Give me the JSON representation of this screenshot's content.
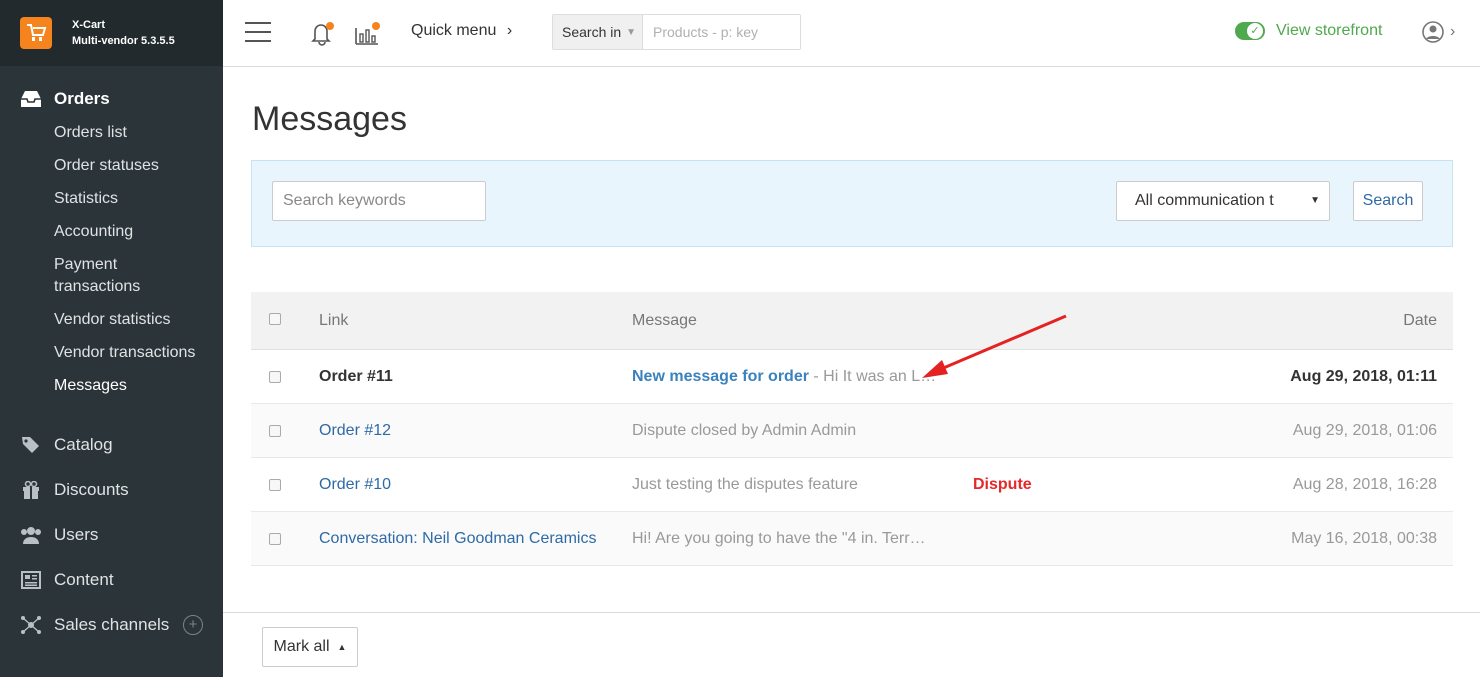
{
  "brand": {
    "name": "X-Cart",
    "version": "Multi-vendor 5.3.5.5"
  },
  "sidebar": {
    "sections": [
      {
        "label": "Orders",
        "icon": "inbox-icon",
        "active": true,
        "items": [
          "Orders list",
          "Order statuses",
          "Statistics",
          "Accounting",
          "Payment transactions",
          "Vendor statistics",
          "Vendor transactions",
          "Messages"
        ],
        "current_item": "Messages"
      },
      {
        "label": "Catalog",
        "icon": "tags-icon"
      },
      {
        "label": "Discounts",
        "icon": "gift-icon"
      },
      {
        "label": "Users",
        "icon": "users-icon"
      },
      {
        "label": "Content",
        "icon": "newspaper-icon"
      },
      {
        "label": "Sales channels",
        "icon": "network-icon"
      }
    ]
  },
  "topbar": {
    "quick_menu": "Quick menu",
    "search_in_label": "Search in",
    "search_placeholder": "Products - p: key",
    "view_storefront": "View storefront",
    "accent_color": "#4fa94e"
  },
  "page": {
    "title": "Messages"
  },
  "filters": {
    "keywords_placeholder": "Search keywords",
    "communication_select": "All communication t",
    "search_button": "Search"
  },
  "table": {
    "headers": {
      "link": "Link",
      "message": "Message",
      "date": "Date"
    },
    "rows": [
      {
        "link": "Order #11",
        "subject": "New message for order",
        "separator": " - ",
        "message": "Hi It was an L…",
        "badge": "",
        "date": "Aug 29, 2018, 01:11",
        "unread": true
      },
      {
        "link": "Order #12",
        "subject": "",
        "separator": "",
        "message": "Dispute closed by Admin Admin",
        "badge": "",
        "date": "Aug 29, 2018, 01:06",
        "unread": false
      },
      {
        "link": "Order #10",
        "subject": "",
        "separator": "",
        "message": "Just testing the disputes feature",
        "badge": "Dispute",
        "date": "Aug 28, 2018, 16:28",
        "unread": false
      },
      {
        "link": "Conversation: Neil Goodman Ceramics",
        "subject": "",
        "separator": "",
        "message": "Hi! Are you going to have the \"4 in. Terr…",
        "badge": "",
        "date": "May 16, 2018, 00:38",
        "unread": false
      }
    ]
  },
  "footer": {
    "mark_all": "Mark all"
  }
}
